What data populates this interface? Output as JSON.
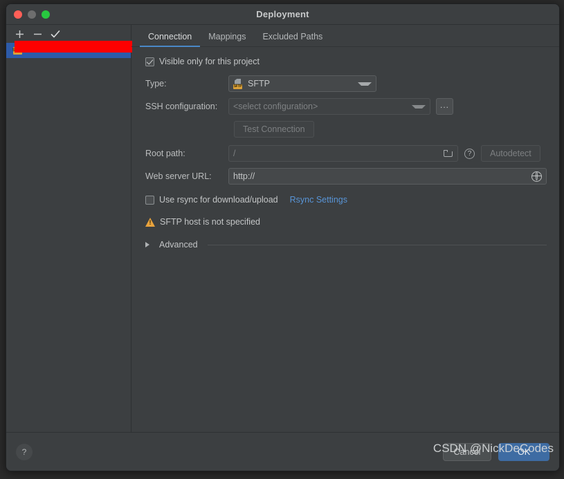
{
  "window": {
    "title": "Deployment",
    "controls": {
      "close": "close",
      "minimize": "minimize",
      "maximize": "maximize"
    }
  },
  "sidebar": {
    "toolbar": [
      {
        "name": "add",
        "glyph": "+"
      },
      {
        "name": "remove",
        "glyph": "−"
      },
      {
        "name": "set-default",
        "glyph": "✓"
      }
    ],
    "items": [
      {
        "label": "",
        "badge": "SFTP",
        "selected": true,
        "redacted": true
      }
    ]
  },
  "tabs": [
    {
      "label": "Connection",
      "active": true
    },
    {
      "label": "Mappings",
      "active": false
    },
    {
      "label": "Excluded Paths",
      "active": false
    }
  ],
  "form": {
    "visible_only": {
      "label": "Visible only for this project",
      "checked": true
    },
    "type": {
      "label": "Type:",
      "value": "SFTP",
      "icon_badge": "SFTP"
    },
    "ssh_configuration": {
      "label": "SSH configuration:",
      "placeholder": "<select configuration>",
      "value": "",
      "browse_label": "..."
    },
    "test_connection": {
      "label": "Test Connection",
      "enabled": false
    },
    "root_path": {
      "label": "Root path:",
      "value": "/",
      "help_glyph": "?",
      "autodetect_label": "Autodetect",
      "autodetect_enabled": false
    },
    "web_server_url": {
      "label": "Web server URL:",
      "value": "http://"
    },
    "rsync": {
      "label": "Use rsync for download/upload",
      "checked": false,
      "settings_link": "Rsync Settings"
    },
    "warning": {
      "text": "SFTP host is not specified"
    },
    "advanced": {
      "label": "Advanced",
      "expanded": false
    }
  },
  "footer": {
    "help_glyph": "?",
    "cancel_label": "Cancel",
    "ok_label": "OK"
  },
  "watermark": {
    "text": "CSDN @NickDeCodes"
  },
  "colors": {
    "window_bg": "#3c3f41",
    "accent_blue": "#4a88c7",
    "selection_blue": "#2d5ba9",
    "ok_button": "#3e6ca3",
    "link_blue": "#5894d6",
    "warning_orange": "#e8a33d",
    "redaction_red": "#fe0000",
    "sftp_badge": "#d9a038"
  }
}
